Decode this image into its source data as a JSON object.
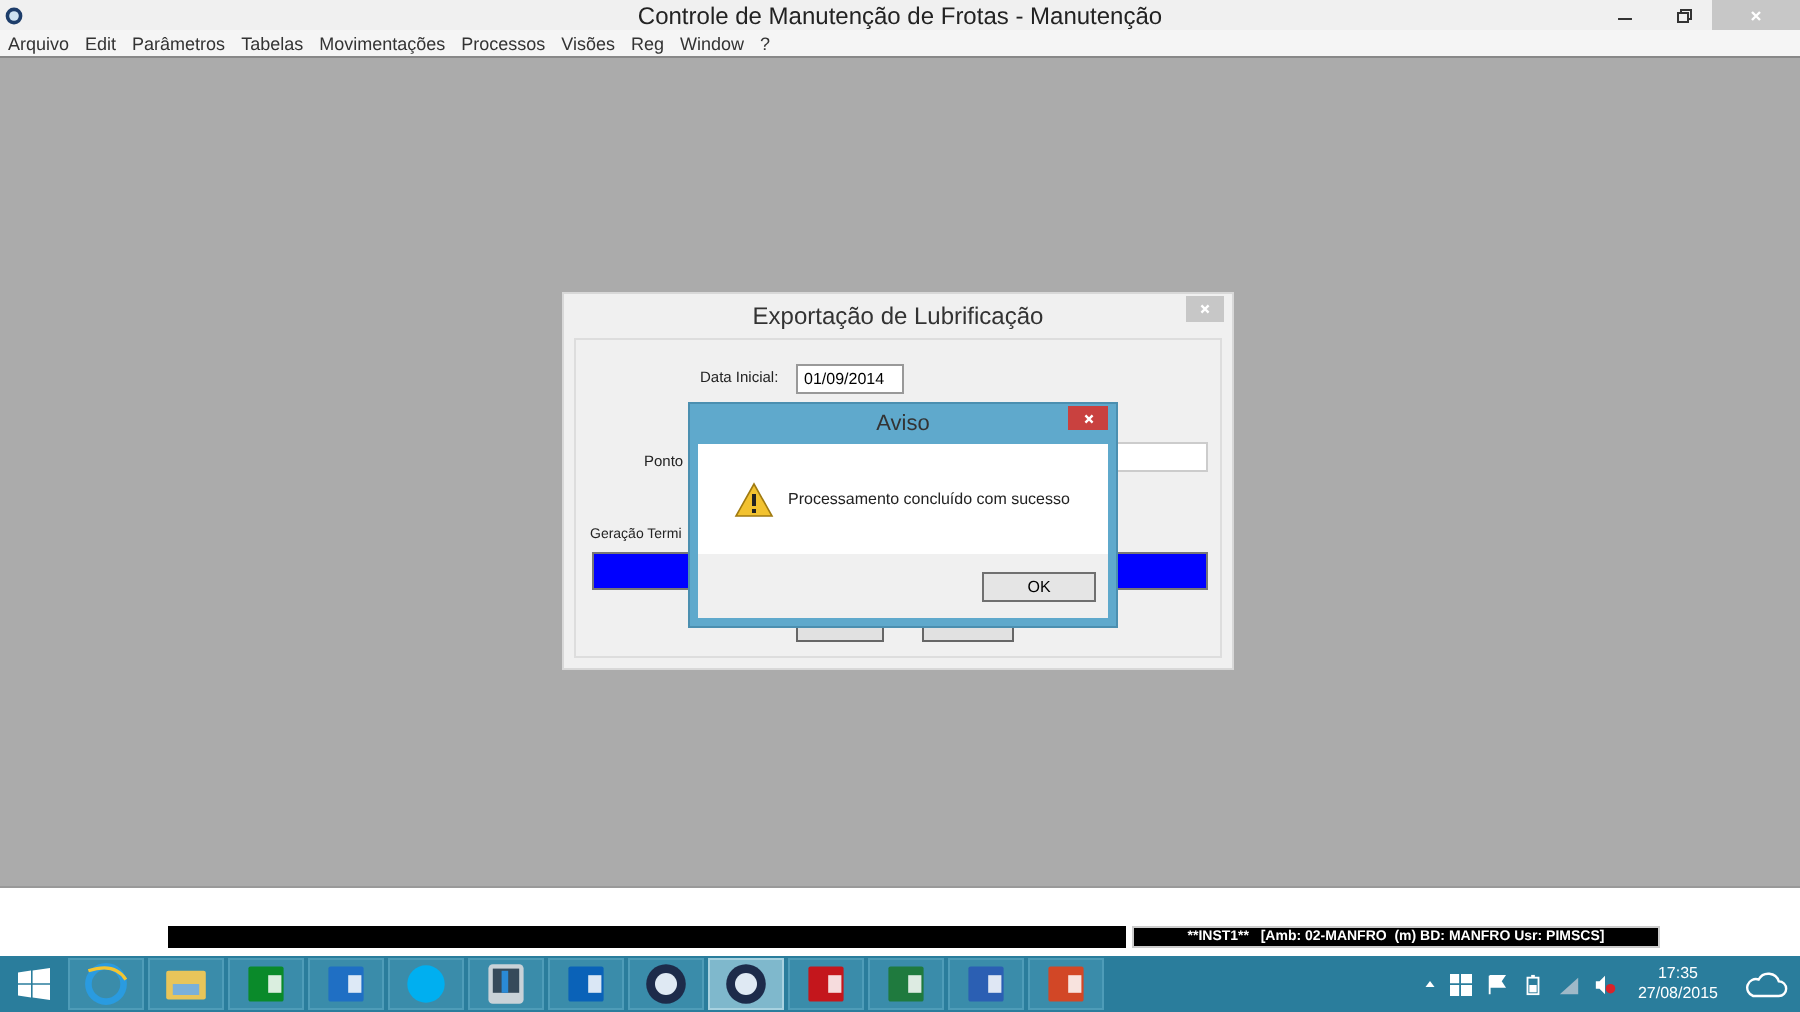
{
  "window": {
    "title": "Controle de Manutenção de Frotas - Manutenção"
  },
  "menu": [
    "Arquivo",
    "Edit",
    "Parâmetros",
    "Tabelas",
    "Movimentações",
    "Processos",
    "Visões",
    "Reg",
    "Window",
    "?"
  ],
  "dialog": {
    "title": "Exportação de Lubrificação",
    "date_label": "Data Inicial:",
    "date_value": "01/09/2014",
    "point_label": "Ponto",
    "progress_label": "Geração Termi",
    "progress": {
      "level": 1
    }
  },
  "alert": {
    "title": "Aviso",
    "message": "Processamento concluído com sucesso",
    "button": "OK"
  },
  "status_bar": {
    "text": "**INST1**   [Amb: 02-MANFRO  (m) BD: MANFRO Usr: PIMSCS]"
  },
  "taskbar": {
    "items": [
      {
        "kind": "ie",
        "selected": false
      },
      {
        "kind": "folder",
        "selected": false
      },
      {
        "kind": "store",
        "selected": false
      },
      {
        "kind": "lync",
        "selected": false
      },
      {
        "kind": "skype",
        "selected": false
      },
      {
        "kind": "monitor",
        "selected": false
      },
      {
        "kind": "outlook",
        "selected": false
      },
      {
        "kind": "app",
        "selected": false
      },
      {
        "kind": "app",
        "selected": true
      },
      {
        "kind": "pdf",
        "selected": false
      },
      {
        "kind": "excel",
        "selected": false
      },
      {
        "kind": "word",
        "selected": false
      },
      {
        "kind": "powerpoint",
        "selected": false
      }
    ],
    "time": "17:35",
    "date": "27/08/2015"
  }
}
